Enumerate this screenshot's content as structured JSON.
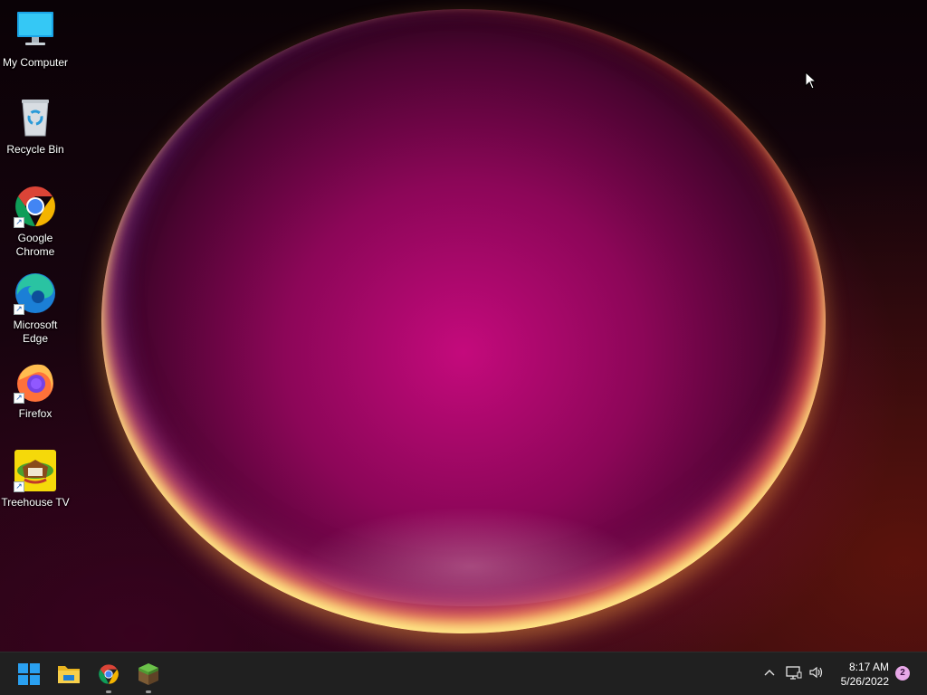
{
  "desktop": {
    "icons": [
      {
        "label": "My Computer",
        "icon": "monitor-icon"
      },
      {
        "label": "Recycle Bin",
        "icon": "recycle-bin-icon"
      },
      {
        "label": "Google Chrome",
        "icon": "chrome-icon"
      },
      {
        "label": "Microsoft Edge",
        "icon": "edge-icon"
      },
      {
        "label": "Firefox",
        "icon": "firefox-icon"
      },
      {
        "label": "Treehouse TV",
        "icon": "treehouse-tv-icon"
      }
    ]
  },
  "taskbar": {
    "pinned": [
      {
        "name": "start-button",
        "icon": "windows-logo-icon",
        "running": false
      },
      {
        "name": "file-explorer-button",
        "icon": "folder-icon",
        "running": false
      },
      {
        "name": "chrome-taskbar-button",
        "icon": "chrome-icon",
        "running": true
      },
      {
        "name": "minecraft-taskbar-button",
        "icon": "grass-block-icon",
        "running": true
      }
    ],
    "tray": {
      "time": "8:17 AM",
      "date": "5/26/2022",
      "notifications": "2",
      "icons": [
        "chevron-up-icon",
        "network-icon",
        "volume-icon"
      ]
    }
  },
  "colors": {
    "taskbar_bg": "#202020",
    "accent_blue": "#1e90ff",
    "badge": "#e8a8e8"
  }
}
